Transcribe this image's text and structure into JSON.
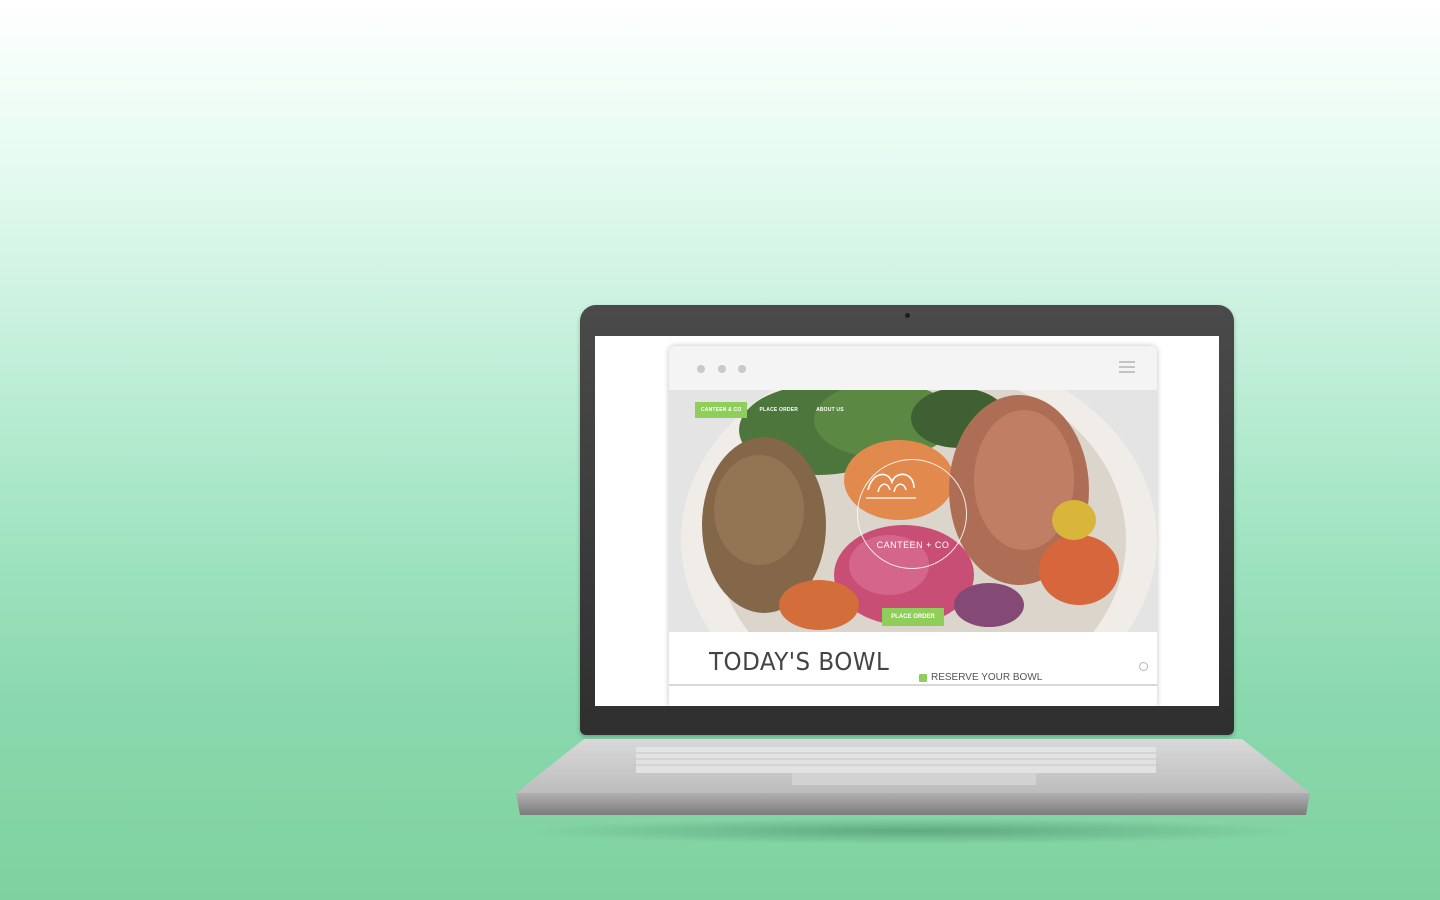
{
  "site": {
    "nav": [
      {
        "label": "Canteen & Co",
        "active": true
      },
      {
        "label": "Place Order",
        "active": false
      },
      {
        "label": "About Us",
        "active": false
      }
    ],
    "logo_text": "CANTEEN + CO",
    "place_order_label": "Place Order",
    "bowl_title": "TODAY'S BOWL",
    "reserve_label": "RESERVE YOUR BOWL"
  },
  "icons": {
    "browser_dots": "window-dots-icon",
    "menu": "hamburger-menu-icon",
    "checkbox": "check-icon",
    "settings": "circle-icon"
  },
  "colors": {
    "accent_green": "#8fce5a",
    "background_top": "#ffffff",
    "background_bottom": "#7fd29f"
  }
}
